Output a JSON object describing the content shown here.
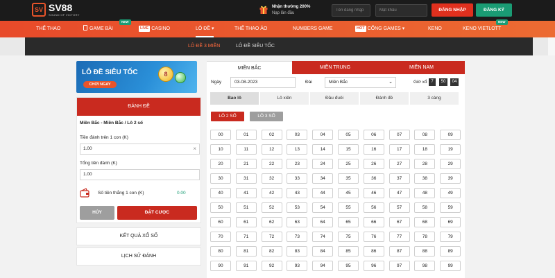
{
  "brand": {
    "name": "SV88",
    "tagline": "SOUND OF VICTORY",
    "mark": "SV"
  },
  "promo": {
    "line1": "Nhận thưởng 200%",
    "line2": "Nạp lần đầu"
  },
  "login": {
    "username_placeholder": "Tên đăng nhập",
    "password_placeholder": "Mật khẩu",
    "login_label": "ĐĂNG NHẬP",
    "register_label": "ĐĂNG KÝ"
  },
  "nav": {
    "items": [
      {
        "label": "THỂ THAO"
      },
      {
        "label": "GAME BÀI",
        "badge": "NEW"
      },
      {
        "tag": "LIVE",
        "label": "CASINO"
      },
      {
        "label": "LÔ ĐỀ ▾"
      },
      {
        "label": "THỂ THAO ẢO"
      },
      {
        "label": "NUMBERS GAME"
      },
      {
        "tag": "HOT",
        "label": "CỔNG GAMES ▾"
      },
      {
        "label": "KENO"
      },
      {
        "label": "KENO VIETLOTT",
        "badge": "NEW"
      }
    ]
  },
  "subnav": {
    "items": [
      {
        "label": "LÔ ĐỀ 3 MIỀN"
      },
      {
        "label": "LÔ ĐỀ SIÊU TỐC"
      }
    ]
  },
  "banner": {
    "title": "LÔ ĐỀ SIÊU TỐC",
    "cta": "CHƠI NGAY",
    "ball_number": "8"
  },
  "bet_panel": {
    "header": "ĐÁNH ĐỀ",
    "subtitle": "Miền Bắc - Miền Bắc / Lô 2 số",
    "per_unit_label": "Tiền đánh trên 1 con (K)",
    "per_unit_value": "1.00",
    "total_label": "Tổng tiền đánh (K)",
    "total_value": "1.00",
    "win_label": "Số tiền thắng 1 con (K)",
    "win_value": "0.00",
    "cancel_label": "HỦY",
    "place_bet_label": "ĐẶT CƯỢC"
  },
  "side_links": {
    "results": "KẾT QUẢ XỔ SỐ",
    "history": "LỊCH SỬ ĐÁNH"
  },
  "regions": {
    "tabs": [
      "MIỀN BẮC",
      "MIỀN TRUNG",
      "MIỀN NAM"
    ],
    "active": 0
  },
  "filters": {
    "date_label": "Ngày",
    "date_value": "03-08-2023",
    "station_label": "Đài",
    "station_value": "Miền Bắc",
    "draw_time_label": "Giờ xổ",
    "draw_time": [
      "7",
      "50",
      "04"
    ]
  },
  "bet_types": {
    "tabs": [
      "Bao lô",
      "Lô xiên",
      "Đầu đuôi",
      "Đánh đề",
      "3 càng"
    ],
    "active": 0
  },
  "sub_types": {
    "buttons": [
      "LÔ 2 SỐ",
      "LÔ 3 SỐ"
    ],
    "active": 0
  },
  "colors": {
    "accent_red": "#c92a1f",
    "nav_orange": "#e84a2a",
    "green": "#1a9c74",
    "topbar": "#1b1b1b"
  },
  "number_grid": {
    "columns": 10,
    "numbers": [
      "00",
      "01",
      "02",
      "03",
      "04",
      "05",
      "06",
      "07",
      "08",
      "09",
      "10",
      "11",
      "12",
      "13",
      "14",
      "15",
      "16",
      "17",
      "18",
      "19",
      "20",
      "21",
      "22",
      "23",
      "24",
      "25",
      "26",
      "27",
      "28",
      "29",
      "30",
      "31",
      "32",
      "33",
      "34",
      "35",
      "36",
      "37",
      "38",
      "39",
      "40",
      "41",
      "42",
      "43",
      "44",
      "45",
      "46",
      "47",
      "48",
      "49",
      "50",
      "51",
      "52",
      "53",
      "54",
      "55",
      "56",
      "57",
      "58",
      "59",
      "60",
      "61",
      "62",
      "63",
      "64",
      "65",
      "66",
      "67",
      "68",
      "69",
      "70",
      "71",
      "72",
      "73",
      "74",
      "75",
      "76",
      "77",
      "78",
      "79",
      "80",
      "81",
      "82",
      "83",
      "84",
      "85",
      "86",
      "87",
      "88",
      "89",
      "90",
      "91",
      "92",
      "93",
      "94",
      "95",
      "96",
      "97",
      "98",
      "99"
    ]
  }
}
